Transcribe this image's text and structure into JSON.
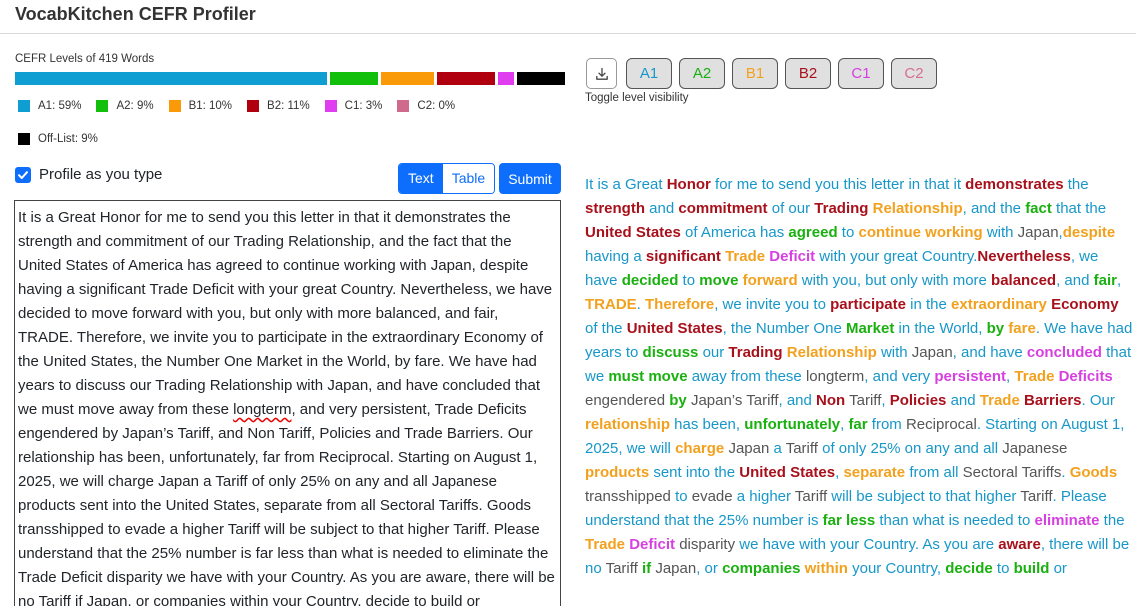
{
  "app": {
    "title": "VocabKitchen CEFR Profiler"
  },
  "cefr": {
    "caption": "CEFR Levels of 419 Words",
    "levels": [
      {
        "key": "A1",
        "label": "A1: 59%",
        "percent": 59,
        "color": "#0e9ed1"
      },
      {
        "key": "A2",
        "label": "A2: 9%",
        "percent": 9,
        "color": "#12c00c"
      },
      {
        "key": "B1",
        "label": "B1: 10%",
        "percent": 10,
        "color": "#fb9a08"
      },
      {
        "key": "B2",
        "label": "B2: 11%",
        "percent": 11,
        "color": "#b00010"
      },
      {
        "key": "C1",
        "label": "C1: 3%",
        "percent": 3,
        "color": "#e13df0"
      },
      {
        "key": "C2",
        "label": "C2: 0%",
        "percent": 0,
        "color": "#d06a8c"
      },
      {
        "key": "OFF",
        "label": "Off-List: 9%",
        "percent": 9,
        "color": "#000000"
      }
    ]
  },
  "controls": {
    "profile_as_you_type": "Profile as you type",
    "profile_as_you_type_checked": true,
    "view_text": "Text",
    "view_table": "Table",
    "submit": "Submit",
    "toggle_caption": "Toggle level visibility",
    "level_buttons": [
      {
        "label": "A1",
        "color": "#1797c9"
      },
      {
        "label": "A2",
        "color": "#19b010"
      },
      {
        "label": "B1",
        "color": "#f2a11e"
      },
      {
        "label": "B2",
        "color": "#a8101b"
      },
      {
        "label": "C1",
        "color": "#d63fe0"
      },
      {
        "label": "C2",
        "color": "#d66f8f"
      }
    ]
  },
  "icons": {
    "download": "download-icon",
    "check": "check-icon"
  },
  "editor": {
    "before_misspelling": "It is a Great Honor for me to send you this letter in that it demonstrates the strength and commitment of our Trading Relationship, and the fact that the United States of America has agreed to continue working with Japan, despite having a significant Trade Deficit with your great Country. Nevertheless, we have decided to move forward with you, but only with more balanced, and fair, TRADE. Therefore, we invite you to participate in the extraordinary Economy of the United States, the Number One Market in the World, by fare. We have had years to discuss our Trading Relationship with Japan, and have concluded that we must move away from these ",
    "misspelled": "longterm",
    "after_misspelling": ", and very persistent, Trade Deficits engendered by Japan’s Tariff, and Non Tariff, Policies and Trade Barriers. Our relationship has been, unfortunately, far from Reciprocal. Starting on August 1, 2025, we will charge Japan a Tariff of only 25% on any and all Japanese products sent into the United States, separate from all Sectoral Tariffs. Goods transshipped to evade a higher Tariff will be subject to that higher Tariff. Please understand that the 25% number is far less than what is needed to eliminate the Trade Deficit disparity we have with your Country. As you are aware, there will be no Tariff if Japan, or companies within your Country, decide to build or"
  },
  "profiled_tokens": [
    [
      "It is a Great ",
      "A1"
    ],
    [
      "Honor",
      "B2"
    ],
    [
      " for me to send you this letter in that it ",
      "A1"
    ],
    [
      "demonstrates",
      "B2"
    ],
    [
      " the ",
      "A1"
    ],
    [
      "strength",
      "B2"
    ],
    [
      " and ",
      "A1"
    ],
    [
      "commitment",
      "B2"
    ],
    [
      " of our ",
      "A1"
    ],
    [
      "Trading",
      "B2"
    ],
    [
      " ",
      "A1"
    ],
    [
      "Relationship",
      "B1"
    ],
    [
      ", and the ",
      "A1"
    ],
    [
      "fact",
      "A2"
    ],
    [
      " that the ",
      "A1"
    ],
    [
      "United States",
      "B2"
    ],
    [
      " of America has ",
      "A1"
    ],
    [
      "agreed",
      "A2"
    ],
    [
      " to ",
      "A1"
    ],
    [
      "continue working",
      "B1"
    ],
    [
      " with ",
      "A1"
    ],
    [
      "Japan",
      "OFF"
    ],
    [
      ",",
      "A1"
    ],
    [
      "despite",
      "B1"
    ],
    [
      " having a ",
      "A1"
    ],
    [
      "significant",
      "B2"
    ],
    [
      " ",
      "A1"
    ],
    [
      "Trade",
      "B1"
    ],
    [
      " ",
      "A1"
    ],
    [
      "Deficit",
      "C1"
    ],
    [
      " with your great Country.",
      "A1"
    ],
    [
      "Nevertheless",
      "B2"
    ],
    [
      ", we have ",
      "A1"
    ],
    [
      "decided",
      "A2"
    ],
    [
      " to ",
      "A1"
    ],
    [
      "move",
      "A2"
    ],
    [
      " ",
      "A1"
    ],
    [
      "forward",
      "B1"
    ],
    [
      " with you, but only with ",
      "A1"
    ],
    [
      "more ",
      "A1"
    ],
    [
      "balanced",
      "B2"
    ],
    [
      ", and ",
      "A1"
    ],
    [
      "fair",
      "A2"
    ],
    [
      ", ",
      "A1"
    ],
    [
      "TRADE",
      "B1"
    ],
    [
      ". ",
      "A1"
    ],
    [
      "Therefore",
      "B1"
    ],
    [
      ", we invite you to ",
      "A1"
    ],
    [
      "participate",
      "B2"
    ],
    [
      " in ",
      "A1"
    ],
    [
      "the ",
      "A1"
    ],
    [
      "extraordinary",
      "B1"
    ],
    [
      " ",
      "A1"
    ],
    [
      "Economy",
      "B2"
    ],
    [
      " of the ",
      "A1"
    ],
    [
      "United States",
      "B2"
    ],
    [
      ", the Number One ",
      "A1"
    ],
    [
      "Market",
      "A2"
    ],
    [
      " in ",
      "A1"
    ],
    [
      "the World, ",
      "A1"
    ],
    [
      "by",
      "A2"
    ],
    [
      " ",
      "A1"
    ],
    [
      "fare",
      "B1"
    ],
    [
      ". We have had years to ",
      "A1"
    ],
    [
      "discuss",
      "A2"
    ],
    [
      " our ",
      "A1"
    ],
    [
      "Trading",
      "B2"
    ],
    [
      " ",
      "A1"
    ],
    [
      "Relationship",
      "B1"
    ],
    [
      " with ",
      "A1"
    ],
    [
      "Japan",
      "OFF"
    ],
    [
      ", and have ",
      "A1"
    ],
    [
      "concluded",
      "C1"
    ],
    [
      " that we ",
      "A1"
    ],
    [
      "must move",
      "A2"
    ],
    [
      " away from these ",
      "A1"
    ],
    [
      "longterm",
      "OFF"
    ],
    [
      ", and very ",
      "A1"
    ],
    [
      "persistent",
      "C1"
    ],
    [
      ", ",
      "A1"
    ],
    [
      "Trade",
      "B1"
    ],
    [
      " ",
      "A1"
    ],
    [
      "Deficits",
      "C1"
    ],
    [
      " engendered ",
      "OFF"
    ],
    [
      "by",
      "A2"
    ],
    [
      " ",
      "A1"
    ],
    [
      "Japan’s Tariff",
      "OFF"
    ],
    [
      ",",
      "A1"
    ],
    [
      " and ",
      "A1"
    ],
    [
      "Non",
      "B2"
    ],
    [
      " ",
      "A1"
    ],
    [
      "Tariff",
      "OFF"
    ],
    [
      ", ",
      "A1"
    ],
    [
      "Policies",
      "B2"
    ],
    [
      " and ",
      "A1"
    ],
    [
      "Trade",
      "B1"
    ],
    [
      " ",
      "A1"
    ],
    [
      "Barriers",
      "B2"
    ],
    [
      ". Our ",
      "A1"
    ],
    [
      "relationship",
      "B1"
    ],
    [
      " has been,",
      "A1"
    ],
    [
      " ",
      "A1"
    ],
    [
      "unfortunately",
      "A2"
    ],
    [
      ", ",
      "A1"
    ],
    [
      "far",
      "A2"
    ],
    [
      " from ",
      "A1"
    ],
    [
      "Reciprocal",
      "OFF"
    ],
    [
      ". Starting on August 1, 2025, we will",
      "A1"
    ],
    [
      " ",
      "A1"
    ],
    [
      "charge",
      "B1"
    ],
    [
      " ",
      "A1"
    ],
    [
      "Japan",
      "OFF"
    ],
    [
      " a ",
      "A1"
    ],
    [
      "Tariff",
      "OFF"
    ],
    [
      " of only 25% on any and all ",
      "A1"
    ],
    [
      "Japanese",
      "OFF"
    ],
    [
      " ",
      "A1"
    ],
    [
      "products",
      "B1"
    ],
    [
      " sent into",
      "A1"
    ],
    [
      " the ",
      "A1"
    ],
    [
      "United States",
      "B2"
    ],
    [
      ", ",
      "A1"
    ],
    [
      "separate",
      "B1"
    ],
    [
      " from all ",
      "A1"
    ],
    [
      "Sectoral Tariffs",
      "OFF"
    ],
    [
      ". ",
      "A1"
    ],
    [
      "Goods",
      "B1"
    ],
    [
      " transshipped ",
      "OFF"
    ],
    [
      "to",
      "A1"
    ],
    [
      " ",
      "A1"
    ],
    [
      "evade",
      "OFF"
    ],
    [
      " a higher ",
      "A1"
    ],
    [
      "Tariff",
      "OFF"
    ],
    [
      " will be subject to that higher ",
      "A1"
    ],
    [
      "Tariff",
      "OFF"
    ],
    [
      ". Please understand",
      "A1"
    ],
    [
      " that the 25% number is ",
      "A1"
    ],
    [
      "far less",
      "A2"
    ],
    [
      " than what is needed to ",
      "A1"
    ],
    [
      "eliminate",
      "C1"
    ],
    [
      " the ",
      "A1"
    ],
    [
      "Trade",
      "B1"
    ],
    [
      " ",
      "A1"
    ],
    [
      "Deficit",
      "C1"
    ],
    [
      " ",
      "A1"
    ],
    [
      "disparity",
      "OFF"
    ],
    [
      " we have with your Country. As you are ",
      "A1"
    ],
    [
      "aware",
      "B2"
    ],
    [
      ", there will be",
      "A1"
    ],
    [
      " ",
      "A1"
    ],
    [
      "no ",
      "A1"
    ],
    [
      "Tariff",
      "OFF"
    ],
    [
      " ",
      "A1"
    ],
    [
      "if",
      "A2"
    ],
    [
      " ",
      "A1"
    ],
    [
      "Japan",
      "OFF"
    ],
    [
      ", or ",
      "A1"
    ],
    [
      "companies",
      "A2"
    ],
    [
      " ",
      "A1"
    ],
    [
      "within",
      "B1"
    ],
    [
      " your Country, ",
      "A1"
    ],
    [
      "decide",
      "A2"
    ],
    [
      " to ",
      "A1"
    ],
    [
      "build",
      "A2"
    ],
    [
      " or",
      "A1"
    ]
  ]
}
